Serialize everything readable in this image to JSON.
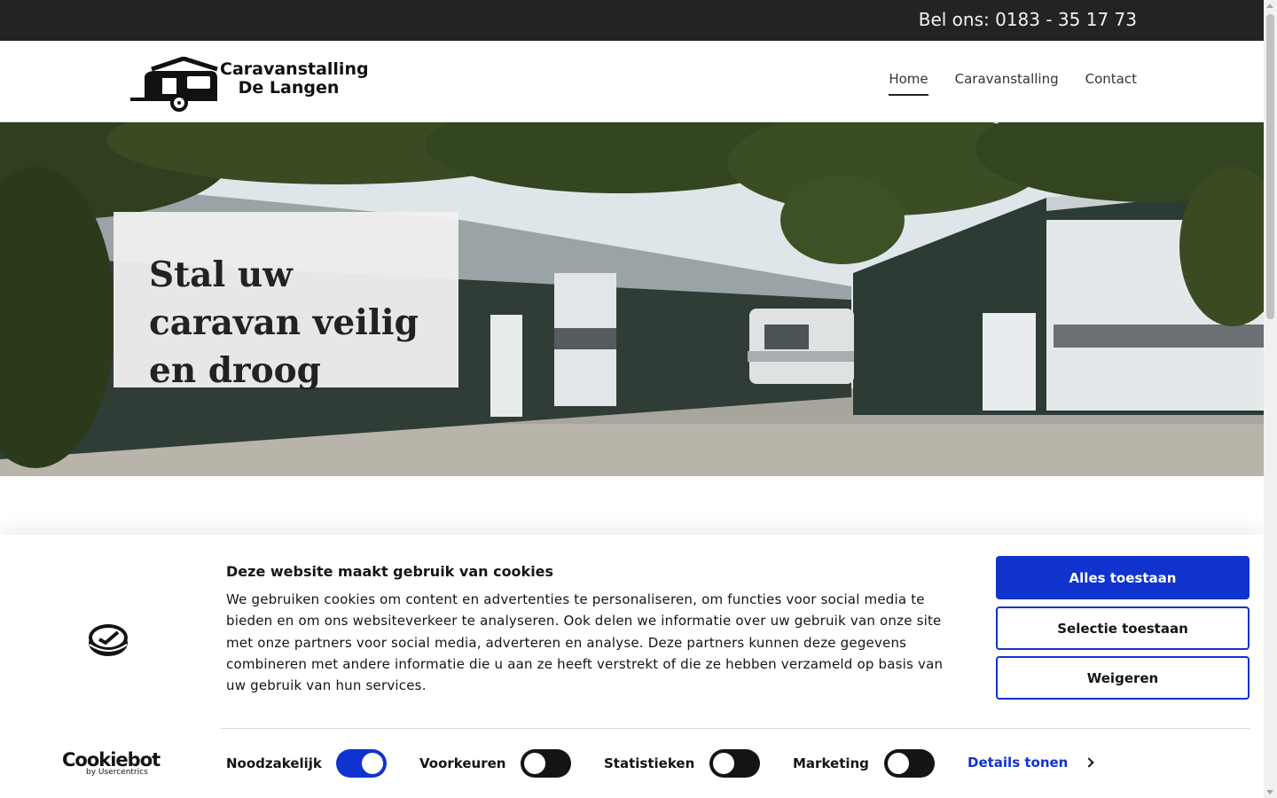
{
  "topbar": {
    "phone": "Bel ons: 0183 - 35 17 73"
  },
  "header": {
    "logo_line1": "Caravanstalling",
    "logo_line2": "De Langen",
    "nav": [
      {
        "label": "Home",
        "active": true
      },
      {
        "label": "Caravanstalling",
        "active": false
      },
      {
        "label": "Contact",
        "active": false
      }
    ]
  },
  "hero": {
    "title": "Stal uw caravan veilig en droog"
  },
  "cookie_banner": {
    "title": "Deze website maakt gebruik van cookies",
    "text": "We gebruiken cookies om content en advertenties te personaliseren, om functies voor social media te bieden en om ons websiteverkeer te analyseren. Ook delen we informatie over uw gebruik van onze site met onze partners voor social media, adverteren en analyse. Deze partners kunnen deze gegevens combineren met andere informatie die u aan ze heeft verstrekt of die ze hebben verzameld op basis van uw gebruik van hun services.",
    "buttons": {
      "allow_all": "Alles toestaan",
      "allow_selection": "Selectie toestaan",
      "deny": "Weigeren"
    },
    "toggles": [
      {
        "label": "Noodzakelijk",
        "checked": true
      },
      {
        "label": "Voorkeuren",
        "checked": false
      },
      {
        "label": "Statistieken",
        "checked": false
      },
      {
        "label": "Marketing",
        "checked": false
      }
    ],
    "details_link": "Details tonen",
    "brand": "Cookiebot",
    "brand_sub": "by Usercentrics",
    "colors": {
      "accent": "#1032cf",
      "text": "#141414"
    }
  }
}
